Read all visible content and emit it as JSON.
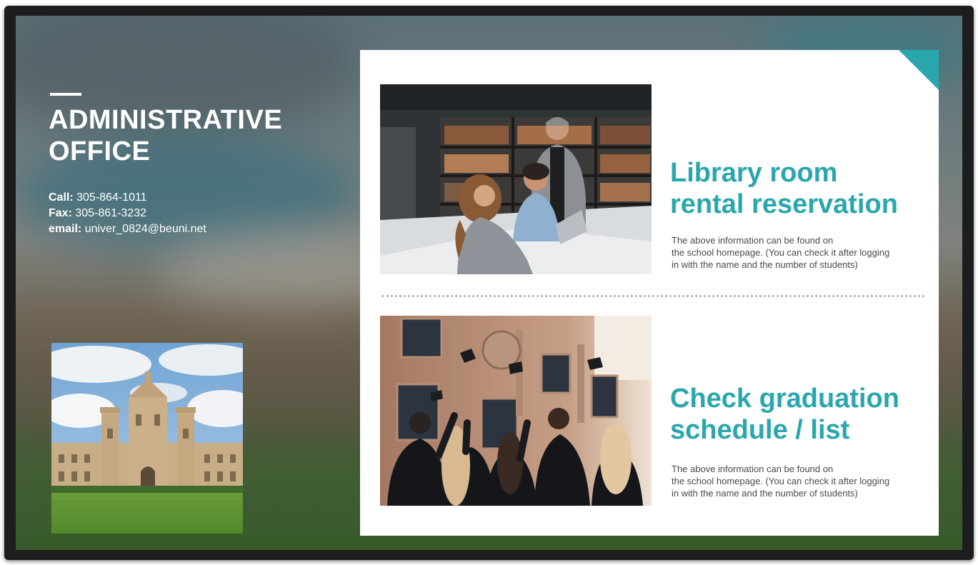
{
  "office": {
    "title_line1": "ADMINISTRATIVE",
    "title_line2": "OFFICE",
    "call_label": "Call:",
    "call_value": "305-864-1011",
    "fax_label": "Fax:",
    "fax_value": "305-861-3232",
    "email_label": "email:",
    "email_value": "univer_0824@beuni.net"
  },
  "sections": [
    {
      "heading_line1": "Library room",
      "heading_line2": "rental reservation",
      "desc_line1": "The above information can be found on",
      "desc_line2": "the school homepage. (You can check it after logging",
      "desc_line3": "in with the name and the number of students)"
    },
    {
      "heading_line1": "Check graduation",
      "heading_line2": "schedule / list",
      "desc_line1": "The above information can be found on",
      "desc_line2": "the school homepage. (You can check it after logging",
      "desc_line3": "in with the name and the number of students)"
    }
  ],
  "colors": {
    "accent": "#2aa7ad",
    "card_bg": "#ffffff",
    "bezel": "#1c1d1f"
  },
  "icons": {
    "corner": "teal-corner-triangle"
  }
}
